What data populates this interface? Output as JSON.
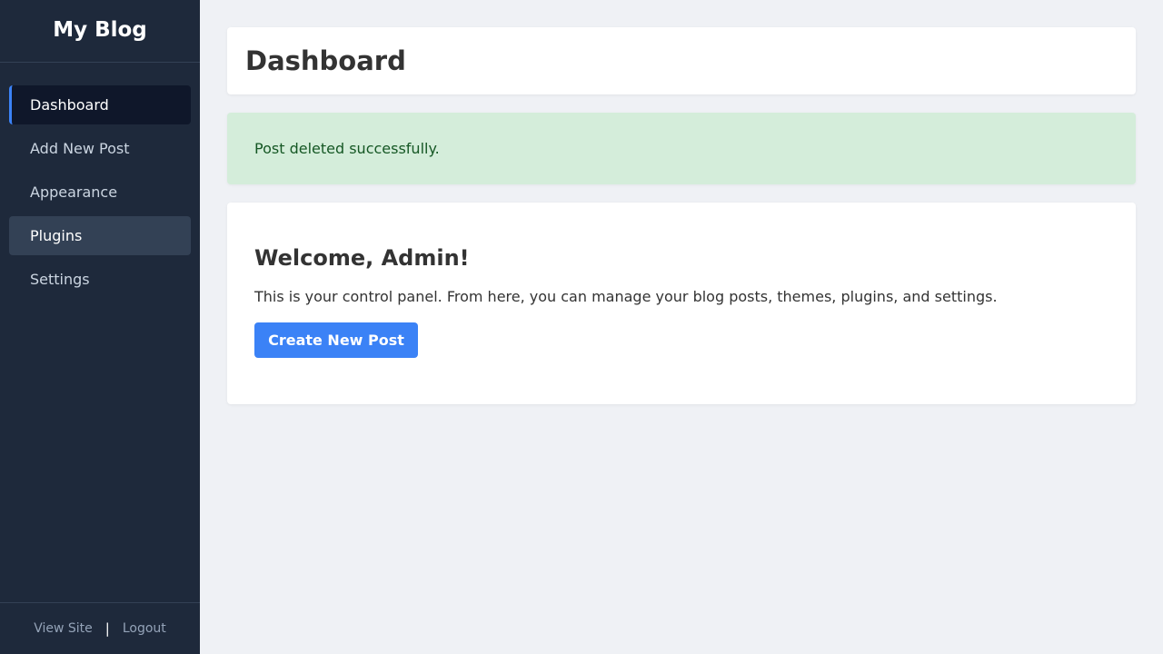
{
  "sidebar": {
    "brand": "My Blog",
    "items": [
      {
        "label": "Dashboard"
      },
      {
        "label": "Add New Post"
      },
      {
        "label": "Appearance"
      },
      {
        "label": "Plugins"
      },
      {
        "label": "Settings"
      }
    ],
    "footer": {
      "view_site": "View Site",
      "separator": "|",
      "logout": "Logout"
    }
  },
  "main": {
    "title": "Dashboard",
    "notice": "Post deleted successfully.",
    "welcome": {
      "heading": "Welcome, Admin!",
      "text": "This is your control panel. From here, you can manage your blog posts, themes, plugins, and settings.",
      "button_label": "Create New Post"
    }
  },
  "colors": {
    "sidebar_bg": "#1e293b",
    "accent": "#3b82f6",
    "success_bg": "#d4edda",
    "success_text": "#155724"
  }
}
